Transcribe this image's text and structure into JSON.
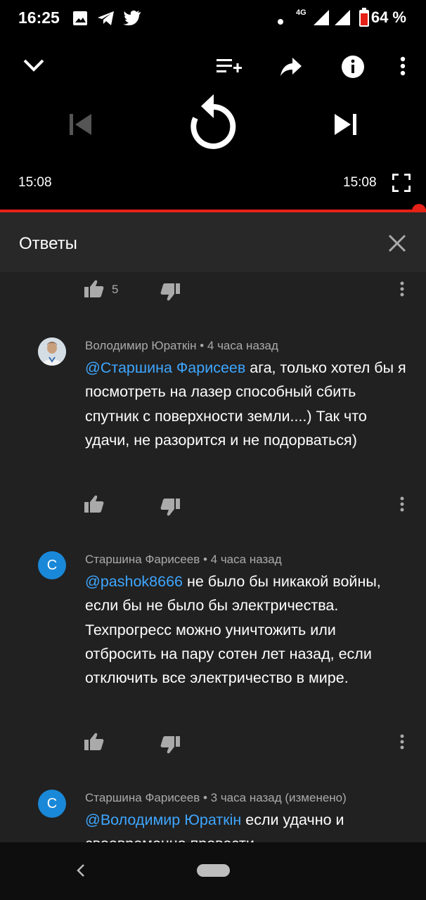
{
  "status_bar": {
    "time": "16:25",
    "network": "4G",
    "battery": "64 %",
    "icons": [
      "gallery-icon",
      "telegram-icon",
      "twitter-icon",
      "dot-icon",
      "signal-icon",
      "battery-icon"
    ]
  },
  "player": {
    "current_time": "15:08",
    "duration": "15:08",
    "progress": 1.0,
    "accent": "#e62117"
  },
  "replies": {
    "title": "Ответы",
    "top_like_count": "5",
    "comments": [
      {
        "author_meta": "Володимир Юраткін • 4 часа назад",
        "mention": "@Старшина Фарисеев",
        "text": " ага, только  хотел бы я посмотреть на лазер способный сбить спутник с поверхности земли....) Так что удачи, не разорится и не подорваться)"
      },
      {
        "avatar_letter": "С",
        "author_meta": "Старшина Фарисеев • 4 часа назад",
        "mention": "@pashok8666",
        "text": " не было бы никакой войны, если бы не было бы электричества. Техпрогресс можно уничтожить или отбросить на пару сотен лет назад, если отключить все электричество в мире."
      },
      {
        "avatar_letter": "С",
        "author_meta": "Старшина Фарисеев • 3 часа назад (изменено)",
        "mention": "@Володимир Юраткін",
        "text": " если удачно и своевременно провести"
      }
    ]
  },
  "colors": {
    "mention": "#3ea6ff",
    "avatar_bg": "#1a88d8",
    "panel_bg": "#212121"
  }
}
